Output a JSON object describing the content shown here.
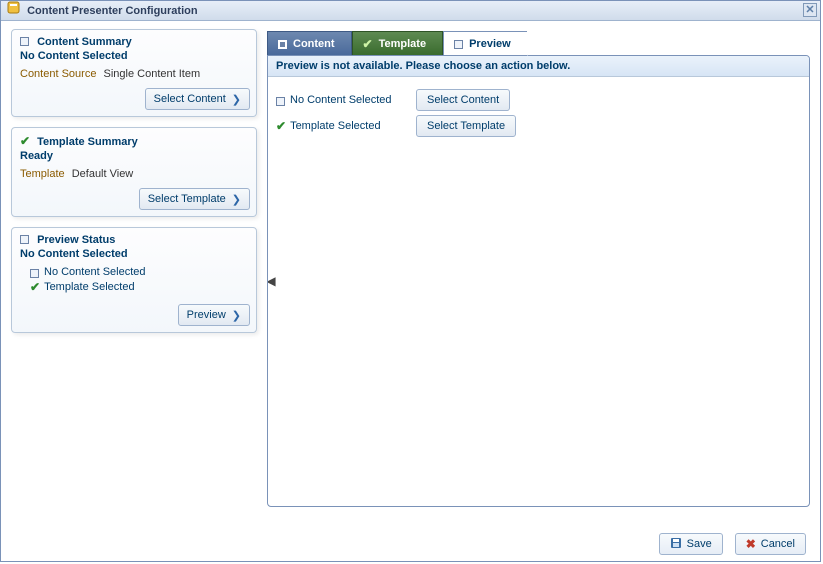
{
  "title": "Content Presenter Configuration",
  "sidebar": {
    "contentSummary": {
      "title": "Content Summary",
      "sub": "No Content Selected",
      "sourceLabel": "Content Source",
      "sourceValue": "Single Content Item",
      "btn": "Select Content"
    },
    "templateSummary": {
      "title": "Template Summary",
      "sub": "Ready",
      "tplLabel": "Template",
      "tplValue": "Default View",
      "btn": "Select Template"
    },
    "previewStatus": {
      "title": "Preview Status",
      "sub": "No Content Selected",
      "item1": "No Content Selected",
      "item2": "Template Selected",
      "btn": "Preview"
    }
  },
  "tabs": {
    "content": "Content",
    "template": "Template",
    "preview": "Preview"
  },
  "main": {
    "message": "Preview is not available. Please choose an action below.",
    "row1Status": "No Content Selected",
    "row1Btn": "Select Content",
    "row2Status": "Template Selected",
    "row2Btn": "Select Template"
  },
  "footer": {
    "save": "Save",
    "cancel": "Cancel"
  }
}
